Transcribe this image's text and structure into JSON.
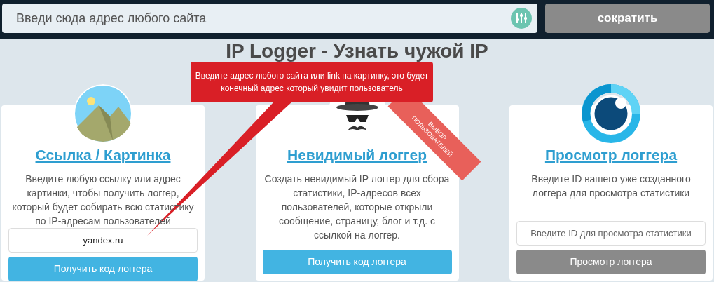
{
  "header": {
    "search": {
      "placeholder": "Введи сюда адрес любого сайта"
    },
    "button": "сократить"
  },
  "heading": "IP Logger - Узнать чужой IP",
  "tooltip": "Введите адрес любого сайта  или link на картинку, это будет конечный адрес который увидит пользователь",
  "cards": [
    {
      "kind": "image",
      "title": "Ссылка / Картинка",
      "description": "Введите любую ссылку или адрес картинки, чтобы получить логгер, который будет собирать всю статистику по IP-адресам пользователей",
      "field": {
        "value": "yandex.ru"
      },
      "button": {
        "label": "Получить код логгера",
        "kind": "primary"
      }
    },
    {
      "kind": "spy",
      "title": "Невидимый логгер",
      "ribbon": "ВЫБОР ПОЛЬЗОВАТЕЛЕЙ",
      "description": "Создать невидимый IP логгер для сбора статистики, IP-адресов всех пользователей, которые открыли сообщение, страницу, блог и т.д. с ссылкой на логгер.",
      "button": {
        "label": "Получить код логгера",
        "kind": "primary"
      }
    },
    {
      "kind": "eye",
      "title": "Просмотр логгера",
      "description": "Введите ID вашего уже созданного логгера для просмотра статистики",
      "field": {
        "placeholder": "Введите ID для просмотра статистики"
      },
      "button": {
        "label": "Просмотр логгера",
        "kind": "secondary"
      }
    }
  ]
}
